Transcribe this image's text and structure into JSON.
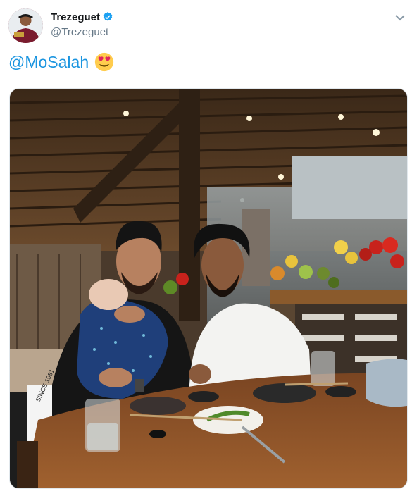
{
  "author": {
    "name": "Trezeguet",
    "handle": "@Trezeguet",
    "verified": true
  },
  "tweet": {
    "mention": "@MoSalah",
    "emoji": "smiling-face-with-heart-eyes"
  },
  "photo": {
    "sweatshirt_text": "SINCE 1981",
    "content": "two men seated at a restaurant table, one holding a baby; vegetable display and kitchen in background"
  },
  "colors": {
    "link": "#1b95e0",
    "verified": "#1da1f2",
    "handle": "#657786",
    "name": "#14171a"
  }
}
